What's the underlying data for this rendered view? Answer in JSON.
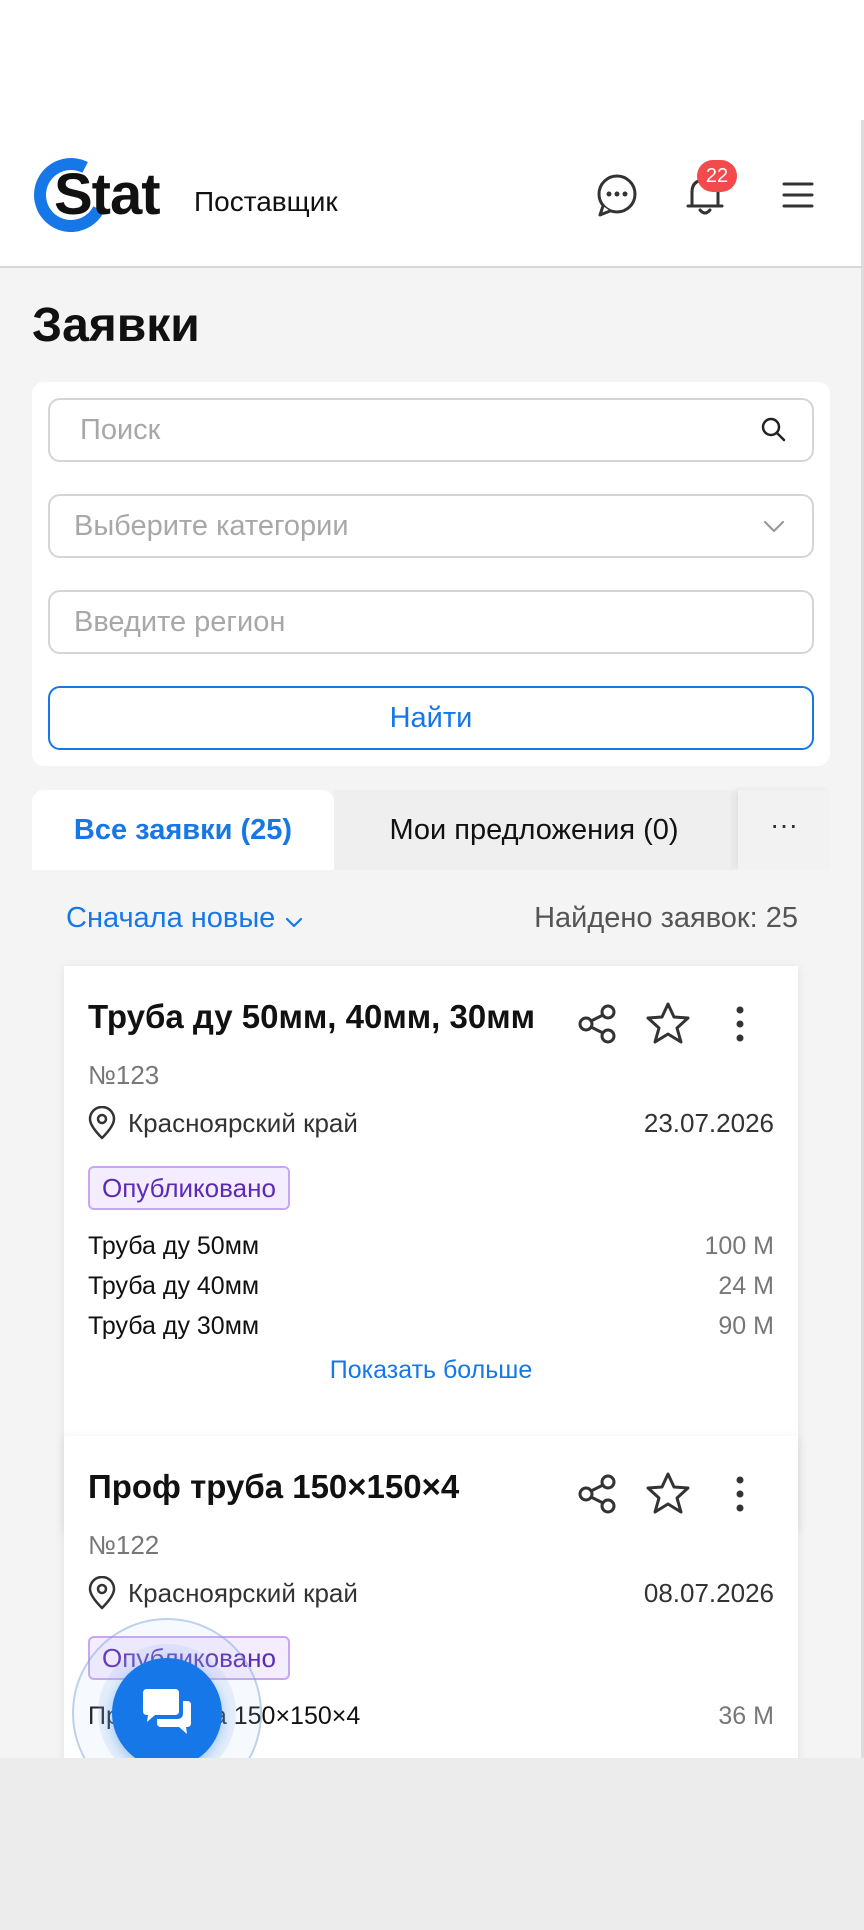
{
  "header": {
    "logo_text": "Stat",
    "role": "Поставщик",
    "notifications_count": "22",
    "accent_color": "#1677e8"
  },
  "page": {
    "title": "Заявки"
  },
  "filters": {
    "search_placeholder": "Поиск",
    "category_placeholder": "Выберите категории",
    "region_placeholder": "Введите регион",
    "find_label": "Найти"
  },
  "tabs": {
    "all": "Все заявки (25)",
    "mine": "Мои предложения (0)",
    "more": "···"
  },
  "list": {
    "sort_label": "Сначала новые",
    "found_label": "Найдено заявок: 25"
  },
  "cards": [
    {
      "title": "Труба ду 50мм, 40мм, 30мм",
      "number": "№123",
      "region": "Красноярский край",
      "date": "23.07.2026",
      "status": "Опубликовано",
      "items": [
        {
          "name": "Труба ду 50мм",
          "qty": "100 М"
        },
        {
          "name": "Труба ду 40мм",
          "qty": "24 М"
        },
        {
          "name": "Труба ду 30мм",
          "qty": "90 М"
        }
      ],
      "show_more": "Показать больше"
    },
    {
      "title": "Проф труба 150×150×4",
      "number": "№122",
      "region": "Красноярский край",
      "date": "08.07.2026",
      "status": "Опубликовано",
      "items": [
        {
          "name": "Проф труба 150×150×4",
          "qty": "36 М"
        }
      ]
    }
  ]
}
